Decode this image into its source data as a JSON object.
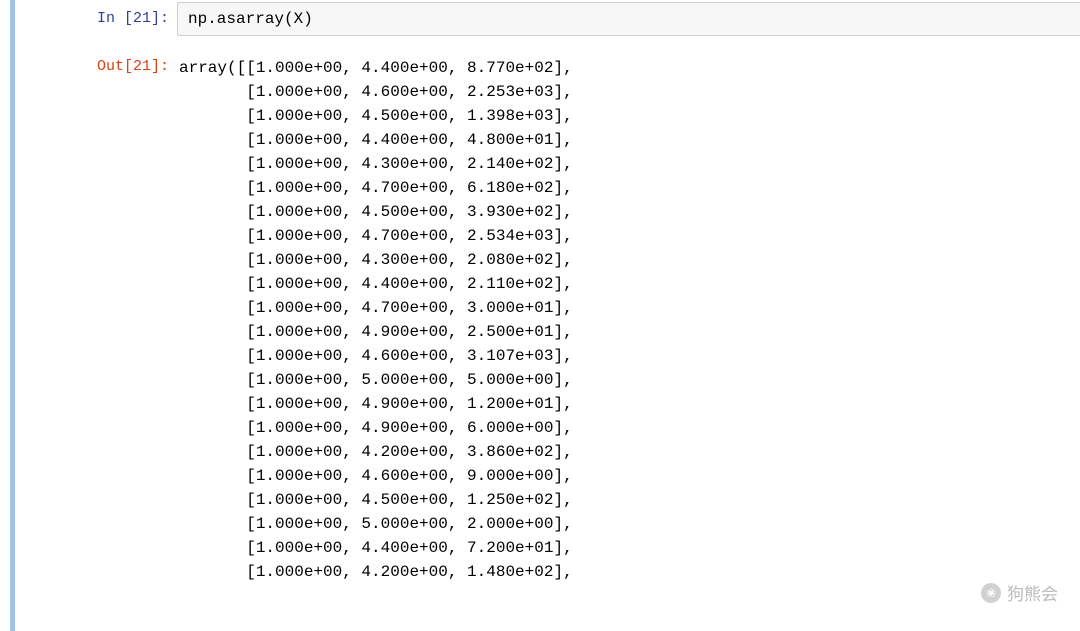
{
  "input_prompt": "In [21]:",
  "output_prompt": "Out[21]:",
  "input_code": "np.asarray(X)",
  "array_header": "array([",
  "array_rows": [
    "[1.000e+00, 4.400e+00, 8.770e+02],",
    "[1.000e+00, 4.600e+00, 2.253e+03],",
    "[1.000e+00, 4.500e+00, 1.398e+03],",
    "[1.000e+00, 4.400e+00, 4.800e+01],",
    "[1.000e+00, 4.300e+00, 2.140e+02],",
    "[1.000e+00, 4.700e+00, 6.180e+02],",
    "[1.000e+00, 4.500e+00, 3.930e+02],",
    "[1.000e+00, 4.700e+00, 2.534e+03],",
    "[1.000e+00, 4.300e+00, 2.080e+02],",
    "[1.000e+00, 4.400e+00, 2.110e+02],",
    "[1.000e+00, 4.700e+00, 3.000e+01],",
    "[1.000e+00, 4.900e+00, 2.500e+01],",
    "[1.000e+00, 4.600e+00, 3.107e+03],",
    "[1.000e+00, 5.000e+00, 5.000e+00],",
    "[1.000e+00, 4.900e+00, 1.200e+01],",
    "[1.000e+00, 4.900e+00, 6.000e+00],",
    "[1.000e+00, 4.200e+00, 3.860e+02],",
    "[1.000e+00, 4.600e+00, 9.000e+00],",
    "[1.000e+00, 4.500e+00, 1.250e+02],",
    "[1.000e+00, 5.000e+00, 2.000e+00],",
    "[1.000e+00, 4.400e+00, 7.200e+01],",
    "[1.000e+00, 4.200e+00, 1.480e+02],"
  ],
  "watermark_text": "狗熊会",
  "watermark_icon_glyph": "❀"
}
